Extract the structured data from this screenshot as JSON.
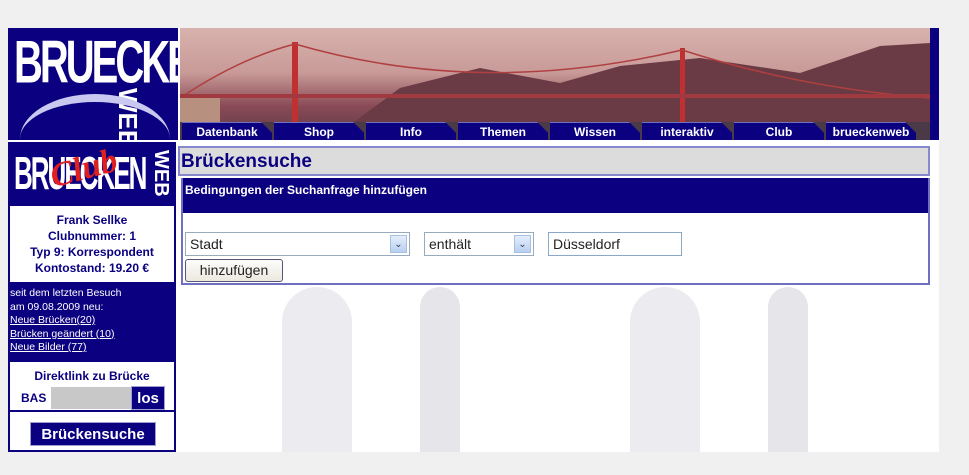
{
  "logo": {
    "text": "BRUECKEN",
    "side": "WEB"
  },
  "club_logo": {
    "text": "BRUECKEN",
    "side": "WEB",
    "script": "Club"
  },
  "nav": [
    "Datenbank",
    "Shop",
    "Info",
    "Themen",
    "Wissen",
    "interaktiv",
    "Club",
    "brueckenweb"
  ],
  "user": {
    "name": "Frank Sellke",
    "club_number": "Clubnummer: 1",
    "type": "Typ 9: Korrespondent",
    "balance": "Kontostand: 19.20 €"
  },
  "news": {
    "line1": "seit dem letzten Besuch",
    "line2": "am 09.08.2009 neu:",
    "links": [
      "Neue Brücken(20)",
      "Brücken geändert (10)",
      "Neue Bilder (77)"
    ]
  },
  "direct": {
    "title": "Direktlink zu Brücke",
    "prefix": "BAS",
    "input_value": "",
    "go": "los"
  },
  "sidebar_search": "Brückensuche",
  "page_title": "Brückensuche",
  "panel": {
    "header": "Bedingungen der Suchanfrage hinzufügen",
    "field": "Stadt",
    "operator": "enthält",
    "value": "Düsseldorf",
    "add": "hinzufügen"
  },
  "colors": {
    "brand": "#0a0080"
  }
}
